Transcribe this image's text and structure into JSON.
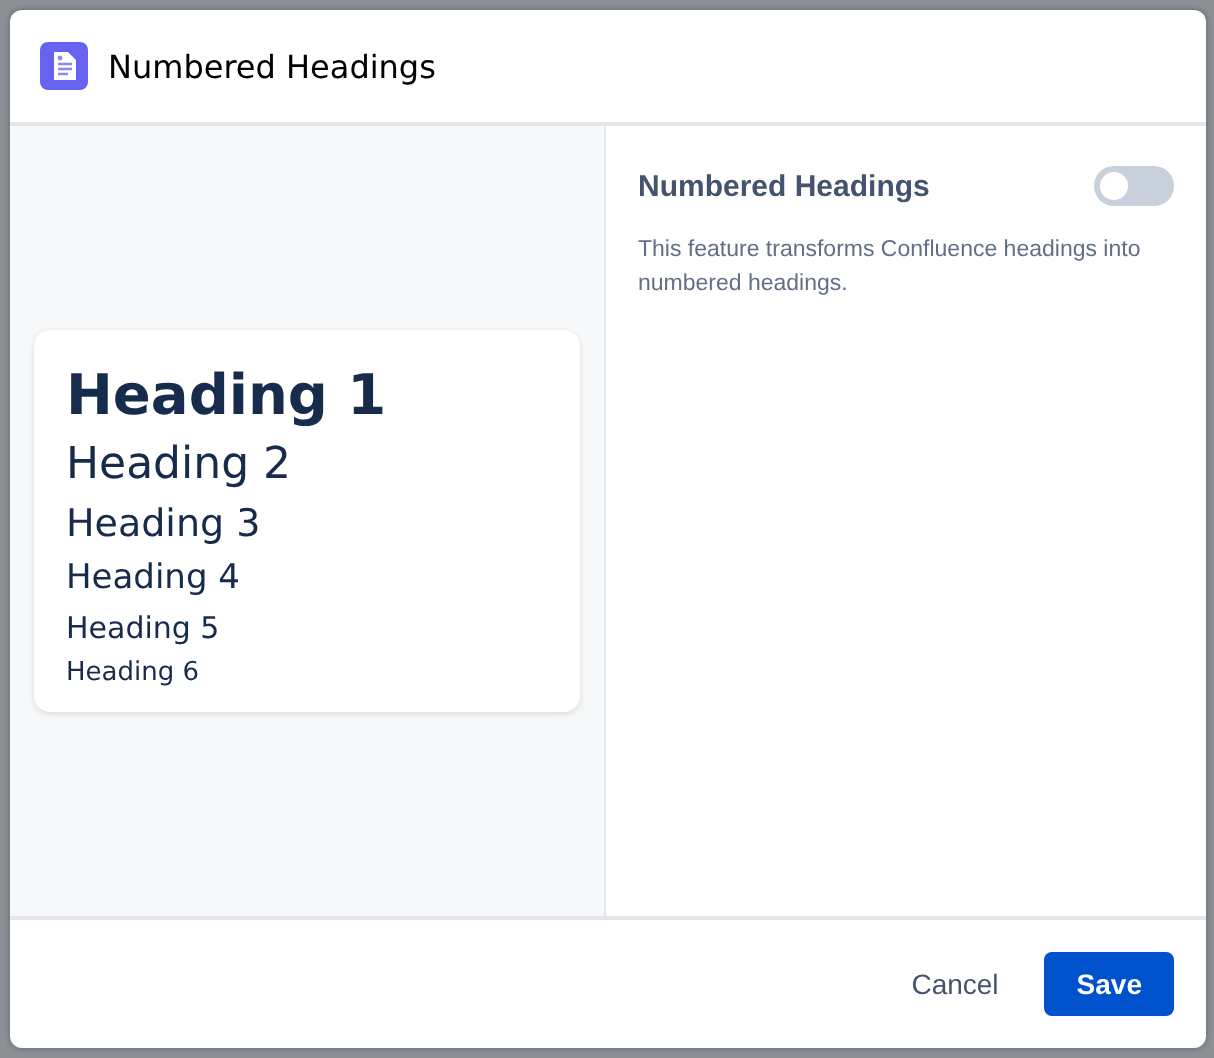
{
  "dialog": {
    "title": "Numbered Headings"
  },
  "preview": {
    "headings": [
      {
        "kind": "h1",
        "text": "Heading 1"
      },
      {
        "kind": "h2",
        "text": "Heading 2"
      },
      {
        "kind": "h3",
        "text": "Heading 3"
      },
      {
        "kind": "h4",
        "text": "Heading 4"
      },
      {
        "kind": "h5",
        "text": "Heading 5"
      },
      {
        "kind": "h6",
        "text": "Heading 6"
      }
    ]
  },
  "settings": {
    "label": "Numbered Headings",
    "on": false,
    "description": "This feature transforms Confluence headings into numbered headings."
  },
  "buttons": [
    {
      "kind": "subtle",
      "label": "Cancel"
    },
    {
      "kind": "primary",
      "label": "Save"
    }
  ]
}
